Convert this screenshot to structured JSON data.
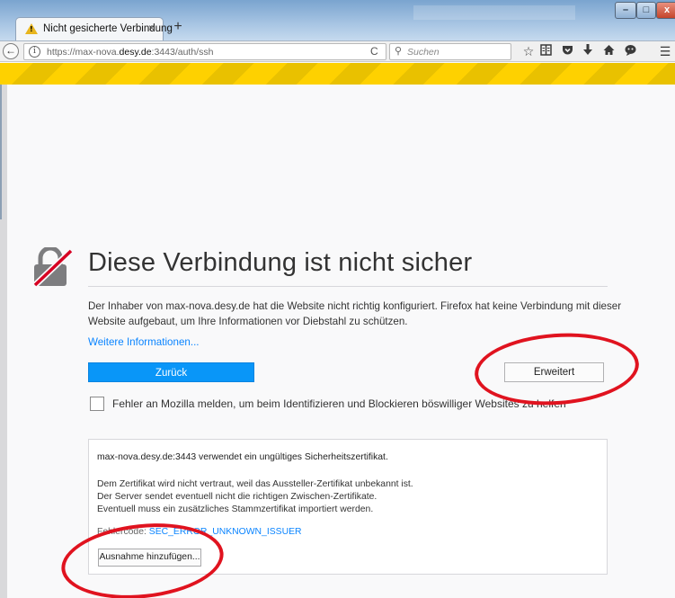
{
  "colors": {
    "accent": "#0996f8",
    "link": "#0a84ff",
    "warning_stripe": "#fed100",
    "annotation": "#e0131f"
  },
  "tab": {
    "title": "Nicht gesicherte Verbindung",
    "close": "×",
    "icon": "warning-triangle-icon"
  },
  "newtab": {
    "label": "+"
  },
  "window_controls": {
    "minimize": "–",
    "maximize": "□",
    "close": "x"
  },
  "nav": {
    "back": "←",
    "url_prefix": "https://max-nova.",
    "url_host": "desy.de",
    "url_suffix": ":3443/auth/ssh",
    "reload": "C",
    "search_placeholder": "Suchen",
    "toolbar_icons": [
      "star-icon",
      "reader-icon",
      "pocket-icon",
      "download-icon",
      "home-icon",
      "chat-icon",
      "menu-icon"
    ]
  },
  "page": {
    "title": "Diese Verbindung ist nicht sicher",
    "description": "Der Inhaber von max-nova.desy.de hat die Website nicht richtig konfiguriert. Firefox hat keine Verbindung mit dieser Website aufgebaut, um Ihre Informationen vor Diebstahl zu schützen.",
    "more_info": "Weitere Informationen...",
    "back_button": "Zurück",
    "advanced_button": "Erweitert",
    "report_label": "Fehler an Mozilla melden, um beim Identifizieren und Blockieren böswilliger Websites zu helfen"
  },
  "details": {
    "header": "max-nova.desy.de:3443 verwendet ein ungültiges Sicherheitszertifikat.",
    "lines": [
      "Dem Zertifikat wird nicht vertraut, weil das Aussteller-Zertifikat unbekannt ist.",
      "Der Server sendet eventuell nicht die richtigen Zwischen-Zertifikate.",
      "Eventuell muss ein zusätzliches Stammzertifikat importiert werden."
    ],
    "code_label": "Fehlercode: ",
    "code_value": "SEC_ERROR_UNKNOWN_ISSUER",
    "exception_button": "Ausnahme hinzufügen..."
  }
}
